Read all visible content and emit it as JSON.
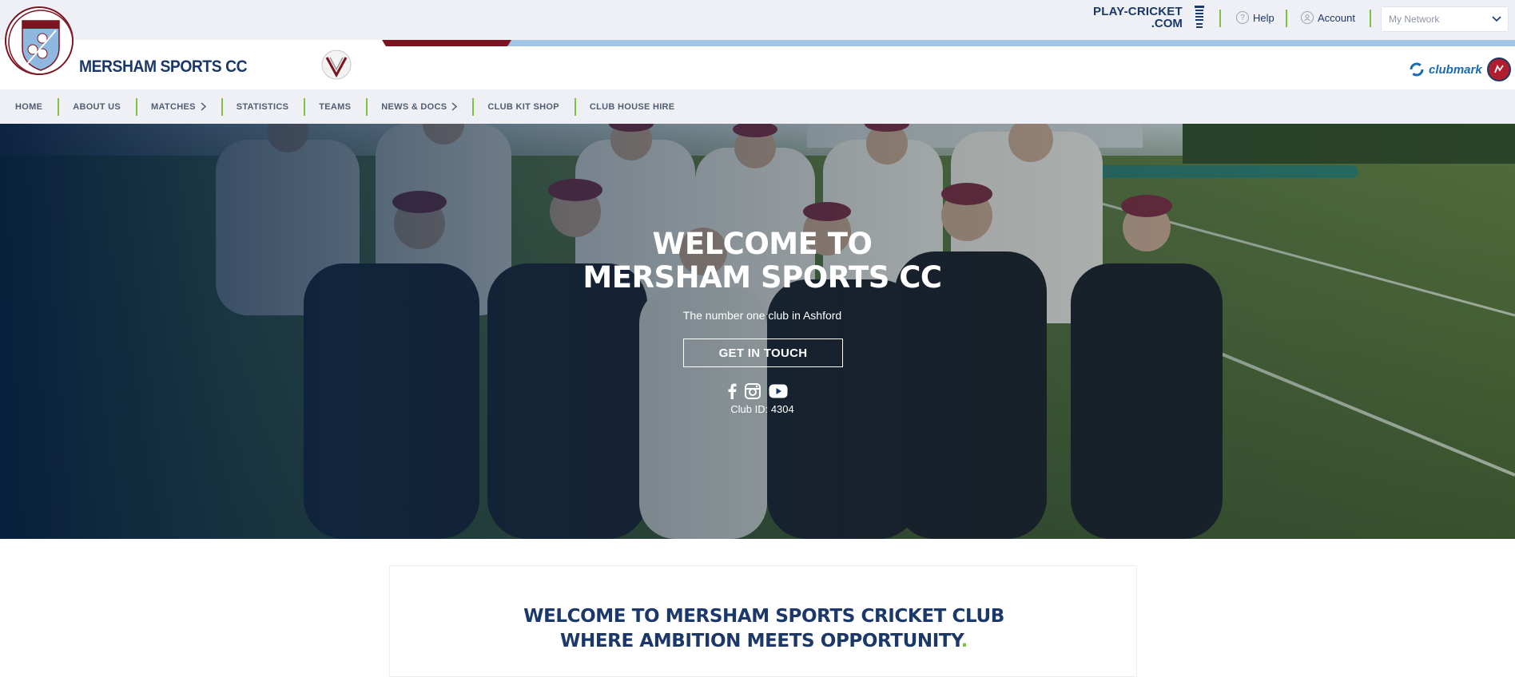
{
  "utility_bar": {
    "brand_line1": "PLAY-CRICKET",
    "brand_line2": ".COM",
    "help_label": "Help",
    "account_label": "Account",
    "network_placeholder": "My Network"
  },
  "club": {
    "name": "MERSHAM SPORTS CC",
    "badge_text": "Mersham Sports Club",
    "badge_letters": [
      "M",
      "C",
      "S"
    ],
    "clubmark_label": "clubmark"
  },
  "nav": {
    "items": [
      {
        "label": "HOME",
        "has_chevron": false
      },
      {
        "label": "ABOUT US",
        "has_chevron": false
      },
      {
        "label": "MATCHES",
        "has_chevron": true
      },
      {
        "label": "STATISTICS",
        "has_chevron": false
      },
      {
        "label": "TEAMS",
        "has_chevron": false
      },
      {
        "label": "NEWS & DOCS",
        "has_chevron": true
      },
      {
        "label": "CLUB KIT SHOP",
        "has_chevron": false
      },
      {
        "label": "CLUB HOUSE HIRE",
        "has_chevron": false
      }
    ]
  },
  "hero": {
    "title_line1": "WELCOME TO",
    "title_line2": "MERSHAM SPORTS CC",
    "subtitle": "The number one club in Ashford",
    "cta_label": "GET IN TOUCH",
    "socials": [
      "facebook-icon",
      "instagram-icon",
      "youtube-icon"
    ],
    "club_id": "Club ID: 4304"
  },
  "welcome_card": {
    "line1": "WELCOME TO MERSHAM SPORTS CRICKET CLUB",
    "line2": "WHERE AMBITION MEETS OPPORTUNITY",
    "dot": "."
  },
  "colors": {
    "navy": "#1b3869",
    "accent_green": "#7dc242",
    "maroon": "#7b1421",
    "light_blue_stripe": "#a4c4e6",
    "bar_bg": "#eef0f6"
  }
}
